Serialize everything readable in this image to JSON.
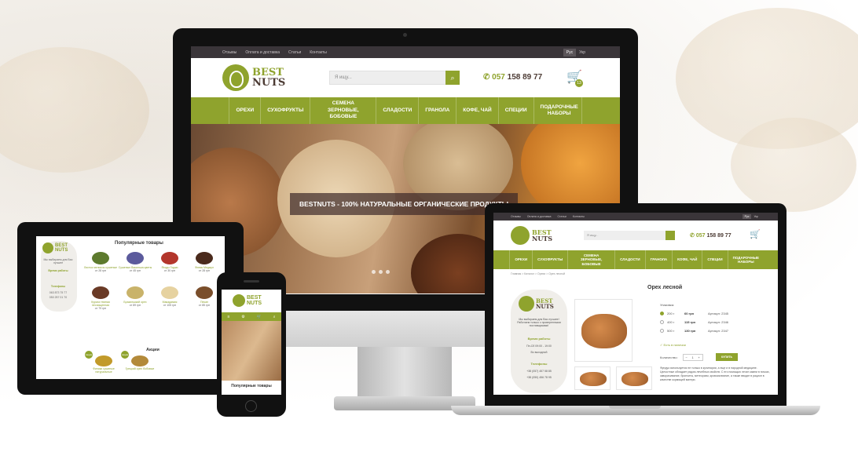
{
  "desktop": {
    "topbar": [
      "Отзывы",
      "Оплата и доставка",
      "Статьи",
      "Контакты"
    ],
    "langs": [
      "Рус",
      "Укр"
    ],
    "logo": {
      "line1": "BEST",
      "line2": "NUTS"
    },
    "search_placeholder": "Я ищу...",
    "phone_prefix": "057",
    "phone_number": "158 89 77",
    "cart_count": "13",
    "nav": [
      "ОРЕХИ",
      "СУХОФРУКТЫ",
      "СЕМЕНА ЗЕРНОВЫЕ, БОБОВЫЕ",
      "СЛАДОСТИ",
      "ГРАНОЛА",
      "КОФЕ, ЧАЙ",
      "СПЕЦИИ",
      "ПОДАРОЧНЫЕ НАБОРЫ"
    ],
    "banner": "BESTNUTS - 100% НАТУРАЛЬНЫЕ ОРГАНИЧЕСКИЕ ПРОДУКТЫ"
  },
  "tablet": {
    "logo": {
      "line1": "BEST",
      "line2": "NUTS"
    },
    "tagline": "Мы выбираем для Вас лучшее",
    "hours_title": "Время работы",
    "phones_title": "Телефоны",
    "phone1": "063 873 75 77",
    "phone2": "050 257 01 70",
    "section_title": "Популярные товары",
    "products": [
      {
        "name": "Листья мелиссы сушеные",
        "price": "от 28 грн"
      },
      {
        "name": "Сушеные Василька цветы",
        "price": "от 45 грн"
      },
      {
        "name": "Ягоды Годжи",
        "price": "от 30 грн"
      },
      {
        "name": "Финик Меджул",
        "price": "от 28 грн"
      },
      {
        "name": "Курага темная неочищенная",
        "price": "от 79 грн"
      },
      {
        "name": "Бразильский орех",
        "price": "от 89 грн"
      },
      {
        "name": "Макадамия",
        "price": "от 105 грн"
      },
      {
        "name": "Пекан",
        "price": "от 85 грн"
      }
    ],
    "promo_title": "Акции",
    "promos": [
      {
        "name": "Финики сушеные натуральные",
        "badge": "Акция"
      },
      {
        "name": "Грецкий орех бобовые",
        "badge": "Акция"
      }
    ]
  },
  "phone": {
    "logo": {
      "line1": "BEST",
      "line2": "NUTS"
    },
    "section_title": "Популярные товары"
  },
  "laptop": {
    "topbar": [
      "Отзывы",
      "Оплата и доставка",
      "Статьи",
      "Контакты"
    ],
    "langs": [
      "Рус",
      "Укр"
    ],
    "logo": {
      "line1": "BEST",
      "line2": "NUTS"
    },
    "search_placeholder": "Я ищу...",
    "phone_prefix": "057",
    "phone_number": "158 89 77",
    "nav": [
      "ОРЕХИ",
      "СУХОФРУКТЫ",
      "СЕМЕНА ЗЕРНОВЫЕ, БОБОВЫЕ",
      "СЛАДОСТИ",
      "ГРАНОЛА",
      "КОФЕ, ЧАЙ",
      "СПЕЦИИ",
      "ПОДАРОЧНЫЕ НАБОРЫ"
    ],
    "breadcrumbs": "Главная  >  Каталог  >  Орехи  >  Орех лесной",
    "side_tagline": "Мы выбираем для Вас лучшее! Работаем только с проверенными поставщиками!",
    "hours_title": "Время работы",
    "hours_weekday": "Пн-Сб   09:00 - 19:00",
    "hours_sunday": "Вс   выходной",
    "phones_title": "Телефоны",
    "phone1": "+38 (057) 457 58 85",
    "phone2": "+38 (050) 456 78 95",
    "product_title": "Орех лесной",
    "packing_label": "Упаковка:",
    "options": [
      {
        "weight": "200 г",
        "price": "60 грн",
        "sku": "Артикул: 2345",
        "selected": true
      },
      {
        "weight": "400 г",
        "price": "115 грн",
        "sku": "Артикул: 2346",
        "selected": false
      },
      {
        "weight": "500 г",
        "price": "130 грн",
        "sku": "Артикул: 2347",
        "selected": false
      }
    ],
    "stock": "✓ Есть в наличии",
    "qty_label": "Количество:",
    "qty_value": "1",
    "buy_label": "КУПИТЬ",
    "description": "Фундук используется не только в кулинарии, а еще и в народной медицине. Целостные обладает рядом лечебных свойств. С его помощью лечат камни в почках, заворачивание, бронхиты, метеоризм, кровоизлияние, а также вводят в рацион в качестве кормящей матери."
  },
  "colors": {
    "brand_green": "#8fa32d",
    "dark_brown": "#4c3b34",
    "topbar": "#3a3539"
  }
}
